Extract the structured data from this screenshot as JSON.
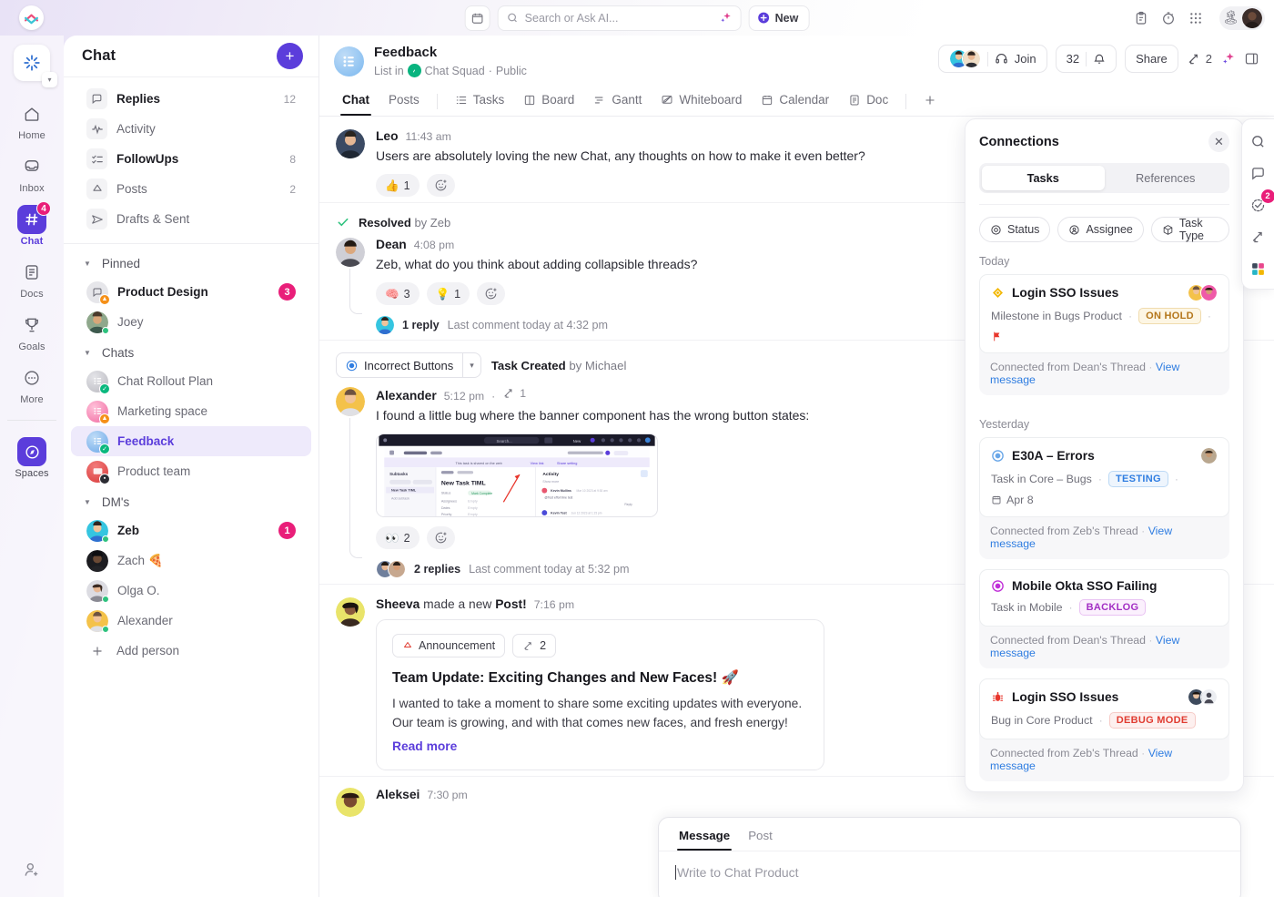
{
  "topbar": {
    "calendar_icon": "calendar-icon",
    "search": {
      "placeholder": "Search or Ask AI...",
      "icon": "search-icon",
      "ai_icon": "sparkle-icon"
    },
    "new_button": "New",
    "right_icons": [
      "clipboard-icon",
      "stopwatch-icon",
      "apps-grid-icon"
    ]
  },
  "rail": {
    "workspace_icon": "workspace-logo",
    "items": [
      {
        "label": "Home",
        "icon": "home-icon",
        "badge": ""
      },
      {
        "label": "Inbox",
        "icon": "inbox-icon",
        "badge": ""
      },
      {
        "label": "Chat",
        "icon": "hash-icon",
        "badge": "4"
      },
      {
        "label": "Docs",
        "icon": "doc-icon",
        "badge": ""
      },
      {
        "label": "Goals",
        "icon": "trophy-icon",
        "badge": ""
      },
      {
        "label": "More",
        "icon": "ellipsis-icon",
        "badge": ""
      }
    ],
    "spaces": {
      "label": "Spaces",
      "icon": "compass-icon"
    },
    "add_person_icon": "add-person-icon"
  },
  "sidebar": {
    "title": "Chat",
    "add_button": "+",
    "nav": [
      {
        "label": "Replies",
        "count": "12",
        "icon": "chat-bubble-icon",
        "strong": true
      },
      {
        "label": "Activity",
        "count": "",
        "icon": "pulse-icon",
        "strong": false
      },
      {
        "label": "FollowUps",
        "count": "8",
        "icon": "checklist-icon",
        "strong": true
      },
      {
        "label": "Posts",
        "count": "2",
        "icon": "megaphone-icon",
        "strong": false
      },
      {
        "label": "Drafts & Sent",
        "count": "",
        "icon": "send-icon",
        "strong": false
      }
    ],
    "groups": [
      {
        "label": "Pinned",
        "items": [
          {
            "label": "Product Design",
            "badge": "3",
            "strong": true,
            "kind": "channel"
          },
          {
            "label": "Joey",
            "badge": "",
            "strong": false,
            "kind": "person"
          }
        ]
      },
      {
        "label": "Chats",
        "items": [
          {
            "label": "Chat Rollout Plan",
            "badge": "",
            "strong": false,
            "kind": "list"
          },
          {
            "label": "Marketing space",
            "badge": "",
            "strong": false,
            "kind": "list"
          },
          {
            "label": "Feedback",
            "badge": "",
            "strong": false,
            "kind": "list",
            "selected": true
          },
          {
            "label": "Product team",
            "badge": "",
            "strong": false,
            "kind": "list"
          }
        ]
      },
      {
        "label": "DM's",
        "items": [
          {
            "label": "Zeb",
            "badge": "1",
            "strong": true,
            "kind": "person"
          },
          {
            "label": "Zach 🍕",
            "badge": "",
            "strong": false,
            "kind": "person"
          },
          {
            "label": "Olga O.",
            "badge": "",
            "strong": false,
            "kind": "person"
          },
          {
            "label": "Alexander",
            "badge": "",
            "strong": false,
            "kind": "person"
          }
        ]
      }
    ],
    "add_person": "Add person"
  },
  "header": {
    "name": "Feedback",
    "subtitle_prefix": "List in",
    "space": "Chat Squad",
    "visibility": "Public",
    "join_label": "Join",
    "member_count": "32",
    "share_label": "Share",
    "connections_count": "2",
    "tabs": [
      {
        "label": "Chat",
        "icon": "",
        "active": true
      },
      {
        "label": "Posts",
        "icon": "",
        "active": false
      },
      {
        "label": "Tasks",
        "icon": "list-icon",
        "active": false
      },
      {
        "label": "Board",
        "icon": "board-icon",
        "active": false
      },
      {
        "label": "Gantt",
        "icon": "gantt-icon",
        "active": false
      },
      {
        "label": "Whiteboard",
        "icon": "whiteboard-icon",
        "active": false
      },
      {
        "label": "Calendar",
        "icon": "calendar-icon",
        "active": false
      },
      {
        "label": "Doc",
        "icon": "doc-icon",
        "active": false
      },
      {
        "label": "+",
        "icon": "plus-icon",
        "active": false
      }
    ]
  },
  "messages": {
    "m1": {
      "author": "Leo",
      "time": "11:43 am",
      "text": "Users are absolutely loving the new Chat, any thoughts on how to make it even better?",
      "reactions": [
        {
          "emoji": "👍",
          "count": "1"
        }
      ]
    },
    "m2": {
      "resolved_label": "Resolved",
      "resolved_by": "by Zeb",
      "author": "Dean",
      "time": "4:08 pm",
      "text": "Zeb, what do you think about adding collapsible threads?",
      "reactions": [
        {
          "emoji": "🧠",
          "count": "3"
        },
        {
          "emoji": "💡",
          "count": "1"
        }
      ],
      "replies_count": "1 reply",
      "replies_meta": "Last comment today at 4:32 pm"
    },
    "m3": {
      "task_chip": "Incorrect Buttons",
      "task_created_label": "Task Created",
      "task_created_by": "by Michael",
      "author": "Alexander",
      "time": "5:12 pm",
      "connections_count": "1",
      "text": "I found a little bug where the banner component has the wrong button states:",
      "attachment": {
        "name": "task-screenshot",
        "title": "New Task TIML",
        "panel_left": "Subtasks",
        "panel_right": "Activity"
      },
      "reactions": [
        {
          "emoji": "👀",
          "count": "2"
        }
      ],
      "replies_count": "2 replies",
      "replies_meta": "Last comment today at 5:32 pm"
    },
    "m4": {
      "author": "Sheeva",
      "action": "made a new",
      "action_object": "Post!",
      "time": "7:16 pm",
      "badge_label": "Announcement",
      "connections_count": "2",
      "title": "Team Update: Exciting Changes and New Faces! 🚀",
      "body": "I wanted to take a moment to share some exciting updates with everyone. Our team is growing, and with that comes new faces, and fresh energy!",
      "read_more": "Read more"
    },
    "m5": {
      "author": "Aleksei",
      "time": "7:30 pm"
    }
  },
  "composer": {
    "tabs": [
      {
        "label": "Message",
        "active": true
      },
      {
        "label": "Post",
        "active": false
      }
    ],
    "placeholder": "Write to Chat Product"
  },
  "connections": {
    "title": "Connections",
    "close_icon": "close-icon",
    "segments": [
      {
        "label": "Tasks",
        "active": true
      },
      {
        "label": "References",
        "active": false
      }
    ],
    "filters": [
      {
        "label": "Status",
        "icon": "status-icon"
      },
      {
        "label": "Assignee",
        "icon": "assignee-icon"
      },
      {
        "label": "Task Type",
        "icon": "cube-icon"
      }
    ],
    "sections": [
      {
        "day": "Today",
        "cards": [
          {
            "title": "Login SSO Issues",
            "type_icon": "milestone-diamond",
            "type_color": "#f2b705",
            "meta": "Milestone in Bugs Product",
            "status": "ON HOLD",
            "status_color": "#b4761a",
            "status_bg": "#fdf6e4",
            "status_border": "#f0dcae",
            "flag": true,
            "avatars": 2,
            "footer": "Connected from Dean's Thread",
            "link": "View message"
          }
        ]
      },
      {
        "day": "Yesterday",
        "cards": [
          {
            "title": "E30A – Errors",
            "type_icon": "task-circle",
            "type_color": "#6aa7e8",
            "meta": "Task in Core – Bugs",
            "status": "TESTING",
            "status_color": "#2f7de1",
            "status_bg": "#eef5fd",
            "status_border": "#bcd9f5",
            "date": "Apr 8",
            "flag": false,
            "avatars": 1,
            "footer": "Connected from Zeb's Thread",
            "link": "View message"
          },
          {
            "title": "Mobile Okta SSO Failing",
            "type_icon": "task-circle",
            "type_color": "#c030d8",
            "meta": "Task in Mobile",
            "status": "BACKLOG",
            "status_color": "#a32fc4",
            "status_bg": "#fbf0fd",
            "status_border": "#e9c3f3",
            "flag": false,
            "avatars": 0,
            "footer": "Connected from Dean's Thread",
            "link": "View message"
          },
          {
            "title": "Login SSO Issues",
            "type_icon": "bug-icon",
            "type_color": "#e8362c",
            "meta": "Bug in Core Product",
            "status": "DEBUG MODE",
            "status_color": "#e03c31",
            "status_bg": "#fdf0ef",
            "status_border": "#f6cbc7",
            "flag": false,
            "avatars": 2,
            "footer": "Connected from Zeb's Thread",
            "link": "View message"
          }
        ]
      }
    ]
  },
  "right_rail": {
    "items": [
      {
        "icon": "search-icon",
        "badge": ""
      },
      {
        "icon": "comment-icon",
        "badge": ""
      },
      {
        "icon": "task-check-icon",
        "badge": "2"
      },
      {
        "icon": "connections-arrows-icon",
        "badge": ""
      },
      {
        "icon": "apps-icon",
        "badge": ""
      }
    ]
  },
  "colors": {
    "accent": "#5b3ddb",
    "badge_pink": "#e91e79",
    "link_blue": "#2f7de1",
    "online_green": "#2ec27e"
  }
}
